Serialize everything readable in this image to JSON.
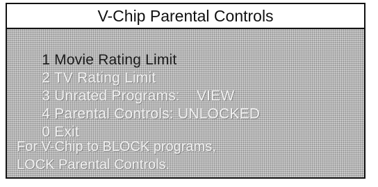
{
  "window": {
    "title": "V-Chip Parental Controls"
  },
  "menu": {
    "items": [
      {
        "label": "1 Movie Rating Limit",
        "value": "",
        "selected": true
      },
      {
        "label": "2 TV Rating Limit",
        "value": "",
        "selected": false
      },
      {
        "label": "3 Unrated Programs:",
        "value": "VIEW",
        "selected": false
      },
      {
        "label": "4 Parental Controls: UNLOCKED",
        "value": "",
        "selected": false
      },
      {
        "label": "0 Exit",
        "value": "",
        "selected": false
      }
    ]
  },
  "notice": {
    "line1": "For V-Chip to BLOCK programs,",
    "line2": "LOCK Parental Controls."
  },
  "colors": {
    "background": "#c9c9c9",
    "border": "#111111",
    "selected_text": "#1a1a1a",
    "inactive_text": "#f2f2f2"
  }
}
